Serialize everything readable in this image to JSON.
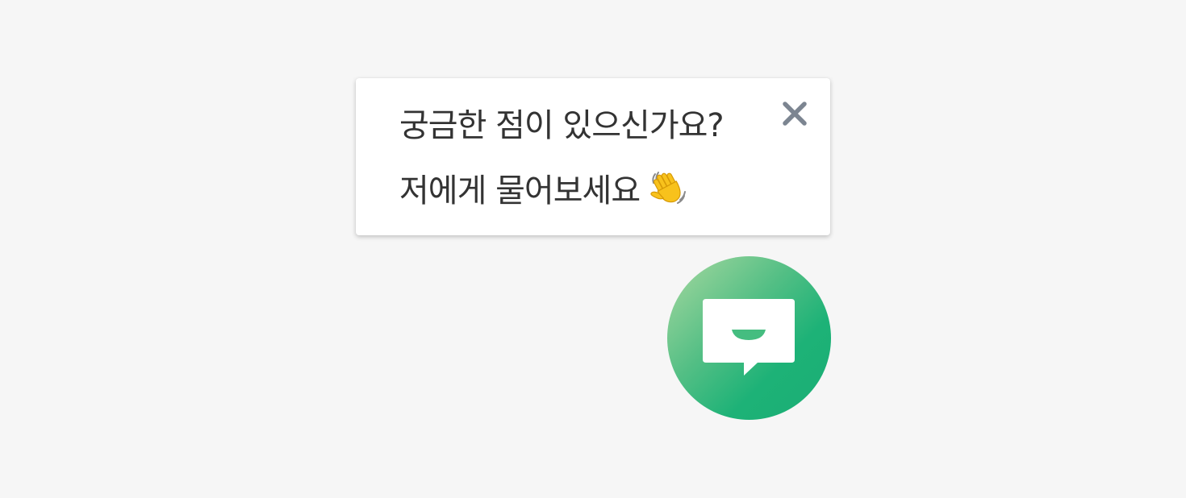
{
  "popup": {
    "line1": "궁금한 점이 있으신가요?",
    "line2": "저에게 물어보세요",
    "emoji": "wave-hand-icon",
    "close_icon": "close-icon"
  },
  "launcher": {
    "icon": "chat-bubble-icon",
    "gradient_start": "#a9d9a0",
    "gradient_end": "#1bae74"
  },
  "colors": {
    "background": "#f6f6f6",
    "text": "#333333",
    "close": "#7c8591"
  }
}
